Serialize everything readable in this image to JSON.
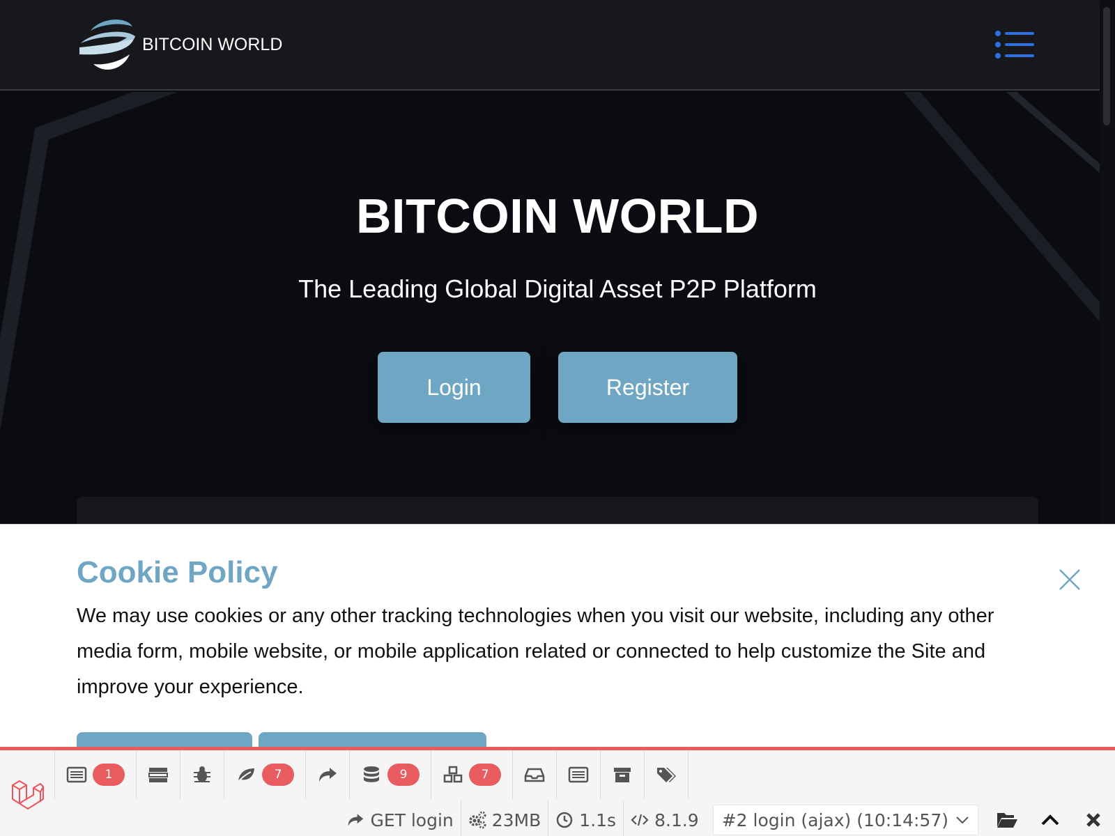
{
  "header": {
    "brand": "BITCOIN WORLD",
    "menu_icon": "hamburger-list-icon"
  },
  "hero": {
    "title": "BITCOIN WORLD",
    "subtitle": "The Leading Global Digital Asset P2P Platform",
    "login_label": "Login",
    "register_label": "Register"
  },
  "cookie": {
    "title": "Cookie Policy",
    "text": "We may use cookies or any other tracking technologies when you visit our website, including any other media form, mobile website, or mobile application related or connected to help customize the Site and improve your experience.",
    "close_icon": "close-icon"
  },
  "debugbar": {
    "tabs": [
      {
        "icon": "messages-icon",
        "badge": "1"
      },
      {
        "icon": "timeline-icon",
        "badge": ""
      },
      {
        "icon": "exceptions-bug-icon",
        "badge": ""
      },
      {
        "icon": "views-leaf-icon",
        "badge": "7"
      },
      {
        "icon": "route-share-icon",
        "badge": ""
      },
      {
        "icon": "queries-database-icon",
        "badge": "9"
      },
      {
        "icon": "models-cubes-icon",
        "badge": "7"
      },
      {
        "icon": "mails-inbox-icon",
        "badge": ""
      },
      {
        "icon": "gate-list-icon",
        "badge": ""
      },
      {
        "icon": "session-archive-icon",
        "badge": ""
      },
      {
        "icon": "request-tags-icon",
        "badge": ""
      }
    ],
    "request": "GET login",
    "memory": "23MB",
    "time": "1.1s",
    "php_version": "8.1.9",
    "dataset": "#2 login (ajax) (10:14:57)"
  },
  "colors": {
    "accent": "#6fa6c4",
    "header_bg": "#17181c",
    "hero_bg": "#0a0c11",
    "debugbar_accent": "#e85b5f",
    "menu_icon": "#2f6fe0"
  }
}
